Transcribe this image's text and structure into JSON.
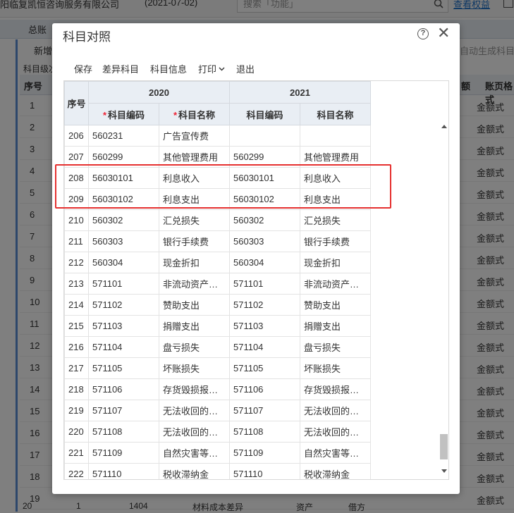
{
  "background": {
    "company": "阳临复凯恒咨询服务有限公司",
    "date": "(2021-07-02)",
    "search_placeholder": "搜索「功能」",
    "link": "查看权益",
    "tab": "总账",
    "new_button": "新增",
    "autogen": "自动生成科目",
    "level_label": "科目级次",
    "header_seq": "序号",
    "header_p": "额",
    "header_format": "账页格式",
    "row_numbers": [
      "1",
      "2",
      "3",
      "4",
      "5",
      "6",
      "7",
      "8",
      "9",
      "10",
      "11",
      "12",
      "13",
      "14",
      "15",
      "16",
      "17",
      "18",
      "19"
    ],
    "format_value": "金额式",
    "bottom_row": {
      "no": "20",
      "b": "1",
      "code": "1404",
      "name": "材料成本差异",
      "type": "资产",
      "dir": "借方"
    }
  },
  "dialog": {
    "title": "科目对照",
    "toolbar": {
      "save": "保存",
      "diff": "差异科目",
      "info": "科目信息",
      "print": "打印",
      "exit": "退出"
    },
    "table": {
      "seq_header": "序号",
      "year_2020": "2020",
      "year_2021": "2021",
      "code_header": "科目编码",
      "name_header": "科目名称",
      "rows": [
        {
          "seq": "206",
          "code20": "560231",
          "name20": "广告宣传费",
          "code21": "",
          "name21": ""
        },
        {
          "seq": "207",
          "code20": "560299",
          "name20": "其他管理费用",
          "code21": "560299",
          "name21": "其他管理费用"
        },
        {
          "seq": "208",
          "code20": "56030101",
          "name20": "利息收入",
          "code21": "56030101",
          "name21": "利息收入"
        },
        {
          "seq": "209",
          "code20": "56030102",
          "name20": "利息支出",
          "code21": "56030102",
          "name21": "利息支出"
        },
        {
          "seq": "210",
          "code20": "560302",
          "name20": "汇兑损失",
          "code21": "560302",
          "name21": "汇兑损失"
        },
        {
          "seq": "211",
          "code20": "560303",
          "name20": "银行手续费",
          "code21": "560303",
          "name21": "银行手续费"
        },
        {
          "seq": "212",
          "code20": "560304",
          "name20": "现金折扣",
          "code21": "560304",
          "name21": "现金折扣"
        },
        {
          "seq": "213",
          "code20": "571101",
          "name20": "非流动资产…",
          "code21": "571101",
          "name21": "非流动资产…"
        },
        {
          "seq": "214",
          "code20": "571102",
          "name20": "赞助支出",
          "code21": "571102",
          "name21": "赞助支出"
        },
        {
          "seq": "215",
          "code20": "571103",
          "name20": "捐赠支出",
          "code21": "571103",
          "name21": "捐赠支出"
        },
        {
          "seq": "216",
          "code20": "571104",
          "name20": "盘亏损失",
          "code21": "571104",
          "name21": "盘亏损失"
        },
        {
          "seq": "217",
          "code20": "571105",
          "name20": "坏账损失",
          "code21": "571105",
          "name21": "坏账损失"
        },
        {
          "seq": "218",
          "code20": "571106",
          "name20": "存货毁损报…",
          "code21": "571106",
          "name21": "存货毁损报…"
        },
        {
          "seq": "219",
          "code20": "571107",
          "name20": "无法收回的…",
          "code21": "571107",
          "name21": "无法收回的…"
        },
        {
          "seq": "220",
          "code20": "571108",
          "name20": "无法收回的…",
          "code21": "571108",
          "name21": "无法收回的…"
        },
        {
          "seq": "221",
          "code20": "571109",
          "name20": "自然灾害等…",
          "code21": "571109",
          "name21": "自然灾害等…"
        },
        {
          "seq": "222",
          "code20": "571110",
          "name20": "税收滞纳金",
          "code21": "571110",
          "name21": "税收滞纳金"
        }
      ]
    }
  },
  "colors": {
    "accent": "#5b8fd6",
    "highlight": "#e5302f",
    "required": "#e22233",
    "header_bg": "#e9eef4"
  }
}
